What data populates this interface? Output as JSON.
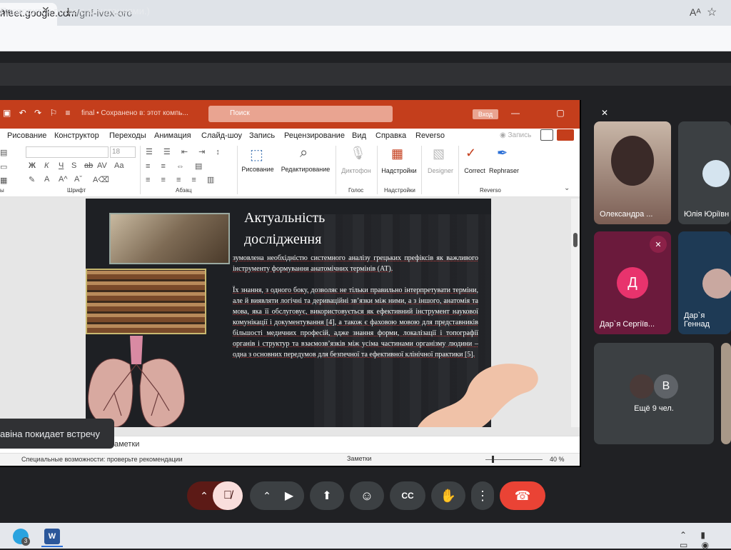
{
  "browser": {
    "tab_title": "oro",
    "url_host": "meet.google.com",
    "url_path": "/gnf-ivex-oro",
    "read_aloud": "Aᴬ"
  },
  "meet": {
    "banner": "Проводится показ с аннотациями.)",
    "toast": "авіна покидает встречу",
    "participants": [
      {
        "name": "Олександра ...",
        "kind": "video"
      },
      {
        "name": "Юлія Юріївн",
        "kind": "video"
      },
      {
        "name": "Дар`я Сергіїв...",
        "kind": "avatar",
        "initial": "Д",
        "color": "#e8336d",
        "muted": true
      },
      {
        "name": "Дар`я Геннад",
        "kind": "video"
      },
      {
        "name": "Ещё 9 чел.",
        "kind": "more",
        "initial": "В"
      }
    ]
  },
  "ppt": {
    "filename": "final • Сохранено в: этот компь...",
    "search_placeholder": "Поиск",
    "login": "Вход",
    "tabs": [
      "Рисование",
      "Конструктор",
      "Переходы",
      "Анимация",
      "Слайд-шоу",
      "Запись",
      "Рецензирование",
      "Вид",
      "Справка",
      "Reverso"
    ],
    "record": "Запись",
    "font_size": "18",
    "groups": {
      "font": "Шрифт",
      "paragraph": "Абзац",
      "voice": "Голос",
      "addins": "Надстройки",
      "reverso": "Reverso",
      "slides": "ы"
    },
    "buttons": {
      "drawing": "Рисование",
      "editing": "Редактирование",
      "dictate": "Диктофон",
      "addins": "Надстройки",
      "designer": "Designer",
      "correct": "Correct",
      "rephraser": "Rephraser"
    },
    "notes": "аметки",
    "status_a11y": "Специальные возможности: проверьте рекомендации",
    "status_notes": "Заметки",
    "zoom": "40 %"
  },
  "slide": {
    "title": "Актуальність дослідження",
    "para1": "зумовлена необхідністю системного аналізу грецьких префіксів як важливого інструменту формування анатомічних термінів (АТ).",
    "para2": "Їх знання, з одного боку, дозволяє не тільки правильно інтерпретувати терміни, але й виявляти логічні та дериваційні зв’язки між ними, а з іншого, анатомія та мова, яка її обслуговує, використовується як ефективний інструмент наукової комунікації і документування [4], а також є фаховою мовою для представників більшості медичних професій, адже знання форми, локалізації і топографії органів і структур та взаємозв’язків між усіма частинами організму людини – одна з основних передумов для безпечної та ефективної клінічної практики [5]."
  },
  "taskbar": {
    "telegram_badge": "3"
  },
  "colors": {
    "ppt_accent": "#c43e1c",
    "meet_bg": "#202124",
    "end_call": "#ea4335",
    "muted_mic_bg": "#f9dedc"
  }
}
